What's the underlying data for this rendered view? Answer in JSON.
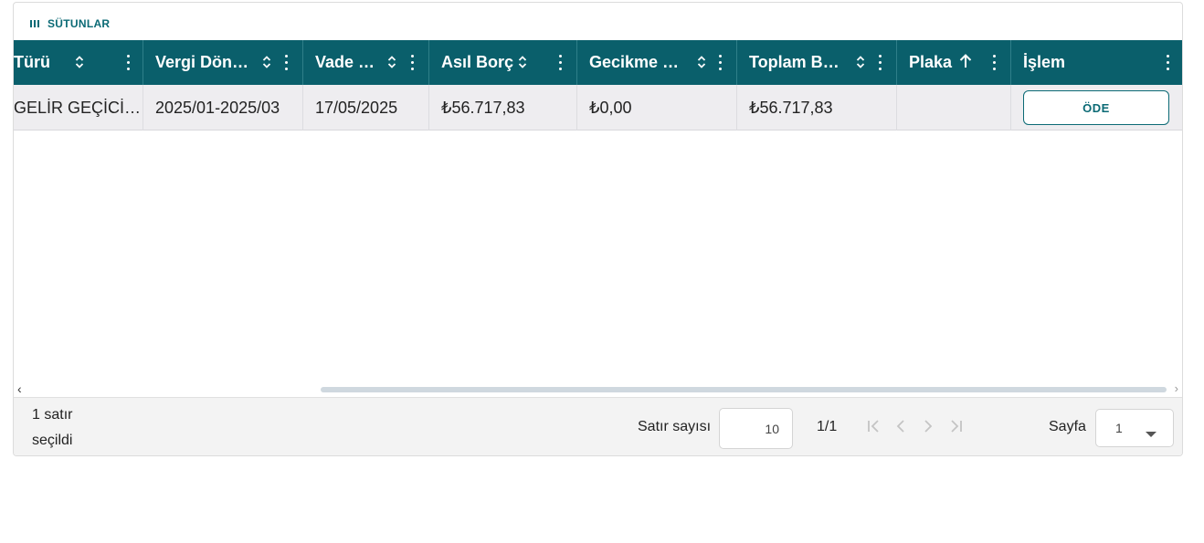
{
  "toolbar": {
    "columns_label": "SÜTUNLAR"
  },
  "columns": [
    {
      "label": "Türü",
      "sortable": true
    },
    {
      "label": "Vergi Dön…",
      "sortable": true
    },
    {
      "label": "Vade …",
      "sortable": true
    },
    {
      "label": "Asıl Borç",
      "sortable": true
    },
    {
      "label": "Gecikme …",
      "sortable": true
    },
    {
      "label": "Toplam B…",
      "sortable": true
    },
    {
      "label": "Plaka",
      "sort": "asc"
    },
    {
      "label": "İşlem"
    }
  ],
  "rows": [
    {
      "turu": "GELİR GEÇİCİ…",
      "vergi_donemi": "2025/01-2025/03",
      "vade": "17/05/2025",
      "asil_borc": "₺56.717,83",
      "gecikme": "₺0,00",
      "toplam": "₺56.717,83",
      "plaka": "",
      "action_label": "ÖDE"
    }
  ],
  "footer": {
    "selected_line1": "1 satır",
    "selected_line2": "seçildi",
    "rows_per_page_label": "Satır sayısı",
    "rows_per_page": "10",
    "page_info": "1/1",
    "page_label": "Sayfa",
    "page_value": "1"
  },
  "colors": {
    "header_bg": "#0a5f6b",
    "accent": "#0b6a75",
    "row_bg": "#eeedf0"
  },
  "icons": {
    "columns": "columns-icon",
    "sort": "sort-unsorted-icon",
    "sort_asc": "arrow-up-icon",
    "menu": "vertical-dots-icon",
    "first": "first-page-icon",
    "prev": "prev-page-icon",
    "next": "next-page-icon",
    "last": "last-page-icon",
    "dropdown": "caret-down-icon"
  }
}
